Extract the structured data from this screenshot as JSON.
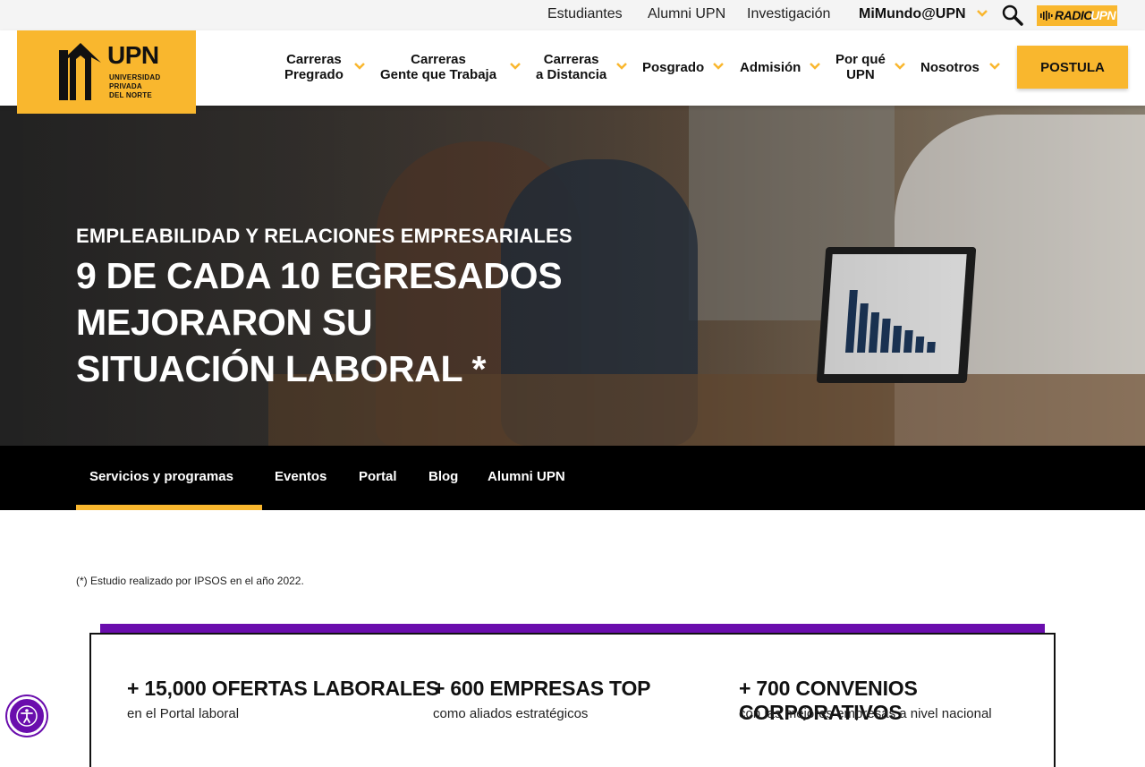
{
  "topbar": {
    "links": [
      "Estudiantes",
      "Alumni UPN",
      "Investigación"
    ],
    "mimundo": "MiMundo@UPN",
    "search_icon": "search-icon",
    "radio_part1": "RADIO",
    "radio_part2": "UPN"
  },
  "logo": {
    "name": "UPN",
    "line1": "UNIVERSIDAD",
    "line2": "PRIVADA",
    "line3": "DEL NORTE"
  },
  "nav": {
    "items": [
      {
        "line1": "Carreras",
        "line2": "Pregrado"
      },
      {
        "line1": "Carreras",
        "line2": "Gente que Trabaja"
      },
      {
        "line1": "Carreras",
        "line2": "a Distancia"
      },
      {
        "line1": "Posgrado",
        "line2": ""
      },
      {
        "line1": "Admisión",
        "line2": ""
      },
      {
        "line1": "Por qué",
        "line2": "UPN"
      },
      {
        "line1": "Nosotros",
        "line2": ""
      }
    ],
    "cta": "POSTULA"
  },
  "hero": {
    "kicker": "EMPLEABILIDAD Y RELACIONES EMPRESARIALES",
    "title_line1": "9 DE CADA 10 EGRESADOS MEJORARON SU",
    "title_line2": "SITUACIÓN LABORAL *"
  },
  "subnav": {
    "tabs": [
      "Servicios y programas",
      "Eventos",
      "Portal",
      "Blog",
      "Alumni UPN"
    ],
    "active": "Servicios y programas"
  },
  "footnote": "(*) Estudio realizado por IPSOS en el año 2022.",
  "stats": [
    {
      "head": "+ 15,000 OFERTAS LABORALES",
      "sub": "en el Portal laboral"
    },
    {
      "head": "+ 600 EMPRESAS TOP",
      "sub": "como aliados estratégicos"
    },
    {
      "head": "+ 700 CONVENIOS CORPORATIVOS",
      "sub": "con las mejores empresas a nivel nacional"
    }
  ],
  "colors": {
    "accent": "#f9b72e",
    "purple": "#6a0dad",
    "dark": "#000000"
  },
  "accessibility_icon": "accessibility-icon"
}
